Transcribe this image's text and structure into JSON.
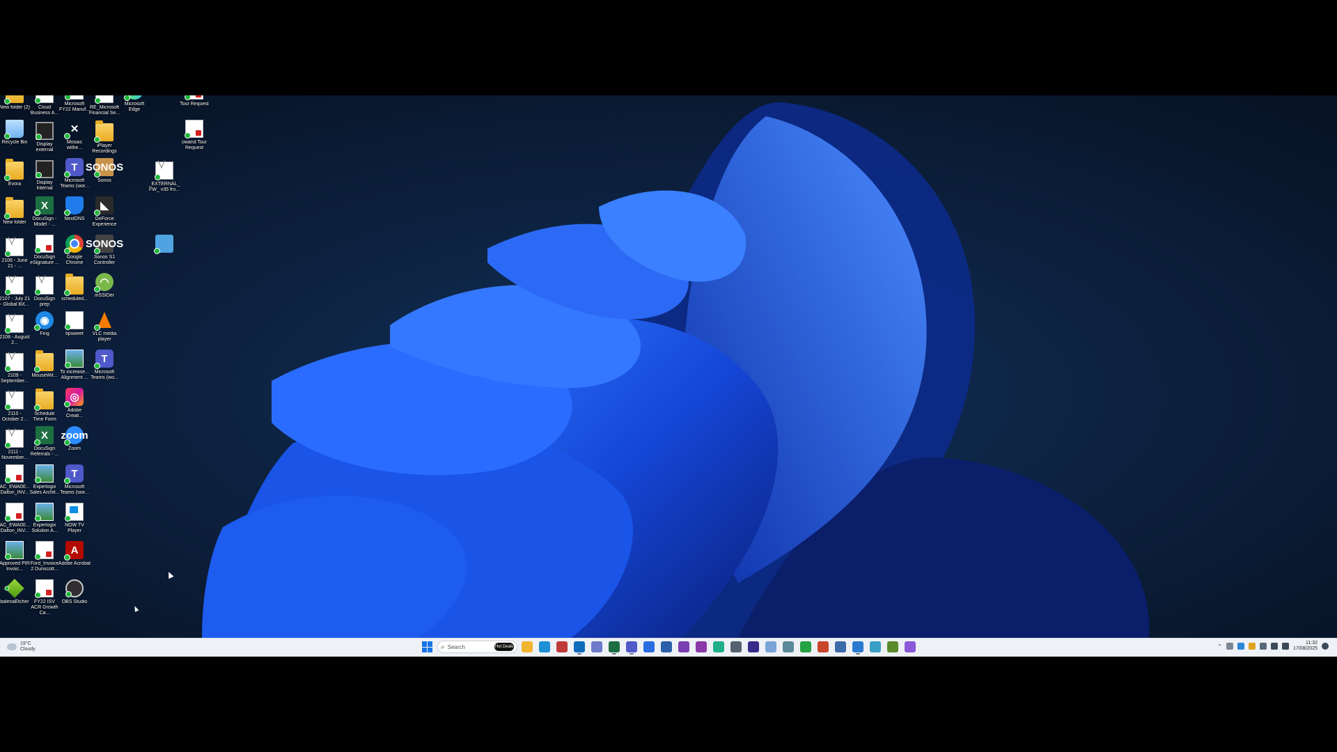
{
  "desktop": {
    "icons": [
      {
        "label": "New folder (2)",
        "kind": "folder",
        "col": 0,
        "row": 0
      },
      {
        "label": "Cloud Business A...",
        "kind": "mail",
        "col": 1,
        "row": 0
      },
      {
        "label": "Microsoft FY22 Manuf...",
        "kind": "doc",
        "col": 2,
        "row": 0
      },
      {
        "label": "RE_Microsoft Financial Se...",
        "kind": "mail",
        "col": 3,
        "row": 0
      },
      {
        "label": "Microsoft Edge",
        "kind": "edge",
        "col": 4,
        "row": 0
      },
      {
        "label": "Tour Request",
        "kind": "pdf",
        "col": 6,
        "row": 0
      },
      {
        "label": "Recycle Bin",
        "kind": "bin",
        "col": 0,
        "row": 1
      },
      {
        "label": "Display external",
        "kind": "monitor",
        "col": 1,
        "row": 1
      },
      {
        "label": "Mosaic withe...",
        "kind": "cross",
        "col": 2,
        "row": 1
      },
      {
        "label": "iPlayer Recordings",
        "kind": "folder",
        "col": 3,
        "row": 1
      },
      {
        "label": "owand Tour Request",
        "kind": "pdf",
        "col": 6,
        "row": 1
      },
      {
        "label": "Evora",
        "kind": "folder",
        "col": 0,
        "row": 2
      },
      {
        "label": "Display Internal",
        "kind": "monitor",
        "col": 1,
        "row": 2
      },
      {
        "label": "Microsoft Teams (wor...",
        "kind": "teams",
        "col": 2,
        "row": 2
      },
      {
        "label": "Sonos",
        "kind": "sonos",
        "col": 3,
        "row": 2
      },
      {
        "label": "_EXTERNAL_ FW_ v35 fro...",
        "kind": "mail",
        "col": 5,
        "row": 2
      },
      {
        "label": "New folder",
        "kind": "folder",
        "col": 0,
        "row": 3
      },
      {
        "label": "DocuSign - Model - ...",
        "kind": "excel",
        "col": 1,
        "row": 3
      },
      {
        "label": "NextDNS",
        "kind": "shield",
        "col": 2,
        "row": 3
      },
      {
        "label": "GeForce Experience",
        "kind": "nvidia",
        "col": 3,
        "row": 3
      },
      {
        "label": "2106 - June 21 - ...",
        "kind": "mail",
        "col": 0,
        "row": 4
      },
      {
        "label": "DocuSign eSignature ...",
        "kind": "pdf",
        "col": 1,
        "row": 4
      },
      {
        "label": "Google Chrome",
        "kind": "chrome",
        "col": 2,
        "row": 4
      },
      {
        "label": "Sonos S1 Controller",
        "kind": "sonosdark",
        "col": 3,
        "row": 4
      },
      {
        "label": "",
        "kind": "app",
        "col": 5,
        "row": 4
      },
      {
        "label": "2107 - July 21 - Global BX...",
        "kind": "mail",
        "col": 0,
        "row": 5
      },
      {
        "label": "DocuSign prep",
        "kind": "mail",
        "col": 1,
        "row": 5
      },
      {
        "label": "scheduled...",
        "kind": "folder",
        "col": 2,
        "row": 5
      },
      {
        "label": "inSSIDer",
        "kind": "wifi",
        "col": 3,
        "row": 5
      },
      {
        "label": "2108 - August 2...",
        "kind": "mail",
        "col": 0,
        "row": 6
      },
      {
        "label": "Fing",
        "kind": "fing",
        "col": 1,
        "row": 6
      },
      {
        "label": "tipsweet",
        "kind": "doc",
        "col": 2,
        "row": 6
      },
      {
        "label": "VLC media player",
        "kind": "vlc",
        "col": 3,
        "row": 6
      },
      {
        "label": "2109 - September...",
        "kind": "mail",
        "col": 0,
        "row": 7
      },
      {
        "label": "MouseWit...",
        "kind": "folder",
        "col": 1,
        "row": 7
      },
      {
        "label": "To increase... Alignment ...",
        "kind": "photo",
        "col": 2,
        "row": 7
      },
      {
        "label": "Microsoft Teams (wo...",
        "kind": "teams",
        "col": 3,
        "row": 7
      },
      {
        "label": "2110 - October 2...",
        "kind": "mail",
        "col": 0,
        "row": 8
      },
      {
        "label": "Schedule Time Form",
        "kind": "folder",
        "col": 1,
        "row": 8
      },
      {
        "label": "Adobe Creati...",
        "kind": "adobe",
        "col": 2,
        "row": 8
      },
      {
        "label": "2111 - November...",
        "kind": "mail",
        "col": 0,
        "row": 9
      },
      {
        "label": "DocuSign Referrals - ...",
        "kind": "excel",
        "col": 1,
        "row": 9
      },
      {
        "label": "Zoom",
        "kind": "zoom",
        "col": 2,
        "row": 9
      },
      {
        "label": "AC_EWA00... Dalton_INV...",
        "kind": "pdf",
        "col": 0,
        "row": 10
      },
      {
        "label": "Experlogix Sales Archit...",
        "kind": "photo",
        "col": 1,
        "row": 10
      },
      {
        "label": "Microsoft Teams (wor...",
        "kind": "teams",
        "col": 2,
        "row": 10
      },
      {
        "label": "AC_EWA00... Dalton_INV...",
        "kind": "pdf",
        "col": 0,
        "row": 11
      },
      {
        "label": "Experlogix Solution A...",
        "kind": "photo",
        "col": 1,
        "row": 11
      },
      {
        "label": "NOW TV Player",
        "kind": "tv",
        "col": 2,
        "row": 11
      },
      {
        "label": "Approved PIR Invoic...",
        "kind": "photo",
        "col": 0,
        "row": 12
      },
      {
        "label": "Ford_Invoice 2 Dunscott...",
        "kind": "pdf",
        "col": 1,
        "row": 12
      },
      {
        "label": "Adobe Acrobat",
        "kind": "acrobat",
        "col": 2,
        "row": 12
      },
      {
        "label": "balenaEtcher",
        "kind": "cube",
        "col": 0,
        "row": 13
      },
      {
        "label": "FY22 ISV ACR Growth Ca...",
        "kind": "pdf",
        "col": 1,
        "row": 13
      },
      {
        "label": "OBS Studio",
        "kind": "obs",
        "col": 2,
        "row": 13
      }
    ]
  },
  "taskbar": {
    "weather": {
      "temp": "19°C",
      "condition": "Cloudy"
    },
    "search_placeholder": "Search",
    "search_badge": "Hot Deals",
    "apps": [
      {
        "name": "file-explorer",
        "color": "#f2b530"
      },
      {
        "name": "edge",
        "color": "#1f8fd6"
      },
      {
        "name": "app-red",
        "color": "#c03a3a"
      },
      {
        "name": "outlook",
        "color": "#0f6cbd",
        "active": true
      },
      {
        "name": "settings",
        "color": "#6c7ac8"
      },
      {
        "name": "excel",
        "color": "#1d6f42",
        "active": true
      },
      {
        "name": "teams",
        "color": "#5059c9",
        "active": true
      },
      {
        "name": "todo",
        "color": "#2a6ee0"
      },
      {
        "name": "word",
        "color": "#2b5faa"
      },
      {
        "name": "onenote",
        "color": "#7a3fb0"
      },
      {
        "name": "onenote-2",
        "color": "#8a3aa8"
      },
      {
        "name": "edge-2",
        "color": "#1fae8a"
      },
      {
        "name": "app-gray",
        "color": "#556070"
      },
      {
        "name": "app-purple",
        "color": "#3a2a8a"
      },
      {
        "name": "photos",
        "color": "#7aa4d8"
      },
      {
        "name": "calculator",
        "color": "#5a8a9a"
      },
      {
        "name": "whatsapp",
        "color": "#25a244"
      },
      {
        "name": "powerpoint",
        "color": "#c9452a"
      },
      {
        "name": "notepad",
        "color": "#3d6aa8"
      },
      {
        "name": "snip",
        "color": "#2a7ad0",
        "active": true
      },
      {
        "name": "app-cyan",
        "color": "#3aa0c8"
      },
      {
        "name": "app-green",
        "color": "#5a8a2a"
      },
      {
        "name": "app-violet",
        "color": "#8a5ad8"
      }
    ],
    "clock": {
      "time": "11:32",
      "date": "17/08/2025"
    }
  }
}
